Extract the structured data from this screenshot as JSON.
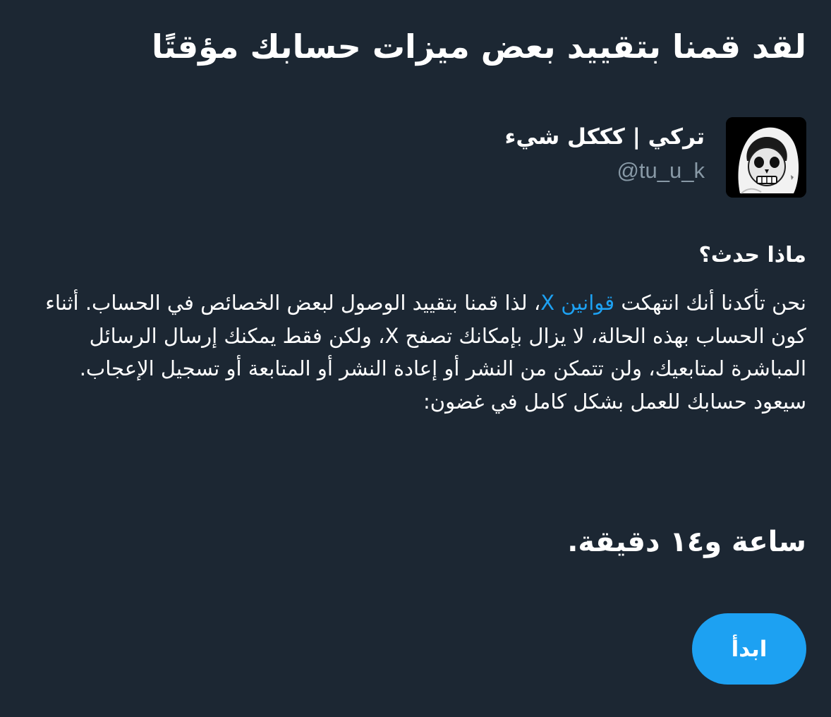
{
  "header": {
    "title": "لقد قمنا بتقييد بعض ميزات حسابك مؤقتًا"
  },
  "profile": {
    "display_name": "تركي | كككل شيء",
    "handle": "@tu_u_k",
    "avatar_icon": "skull-face-avatar"
  },
  "section": {
    "heading": "ماذا حدث؟"
  },
  "body": {
    "text_before_link": "نحن تأكدنا أنك انتهكت ",
    "link_label": "قوانين X",
    "text_after_link": "، لذا قمنا بتقييد الوصول لبعض الخصائص في الحساب. أثناء كون الحساب بهذه الحالة، لا يزال بإمكانك تصفح X، ولكن فقط يمكنك إرسال الرسائل المباشرة لمتابعيك، ولن تتمكن من النشر أو إعادة النشر أو المتابعة أو تسجيل الإعجاب. سيعود حسابك للعمل بشكل كامل في غضون:"
  },
  "countdown": {
    "text": "ساعة و١٤ دقيقة."
  },
  "actions": {
    "start_label": "ابدأ"
  },
  "colors": {
    "background": "#1c2733",
    "text": "#ffffff",
    "secondary_text": "#8899a6",
    "accent": "#1da1f2"
  }
}
